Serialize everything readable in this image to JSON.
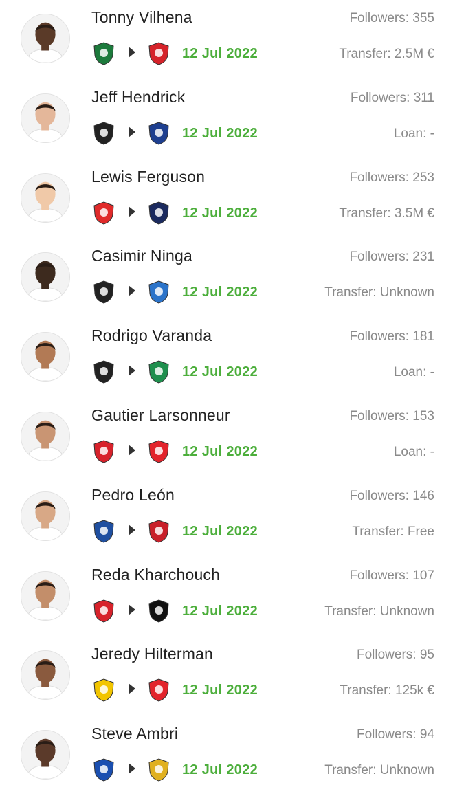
{
  "transfers": [
    {
      "player": "Tonny Vilhena",
      "followers": "Followers: 355",
      "fee": "Transfer: 2.5M €",
      "date": "12 Jul 2022",
      "from_icon": "krasnodar-crest-icon",
      "to_icon": "espanyol-crest-icon",
      "from_color": "#1c7a3c",
      "to_color": "#d5232a",
      "skin": "#5a3a28"
    },
    {
      "player": "Jeff Hendrick",
      "followers": "Followers: 311",
      "fee": "Loan: -",
      "date": "12 Jul 2022",
      "from_icon": "newcastle-crest-icon",
      "to_icon": "reading-crest-icon",
      "from_color": "#222222",
      "to_color": "#1e3f8f",
      "skin": "#e4b79a"
    },
    {
      "player": "Lewis Ferguson",
      "followers": "Followers: 253",
      "fee": "Transfer: 3.5M €",
      "date": "12 Jul 2022",
      "from_icon": "aberdeen-crest-icon",
      "to_icon": "bologna-crest-icon",
      "from_color": "#e02a2a",
      "to_color": "#1b2a5e",
      "skin": "#f0c9a8"
    },
    {
      "player": "Casimir Ninga",
      "followers": "Followers: 231",
      "fee": "Transfer: Unknown",
      "date": "12 Jul 2022",
      "from_icon": "angers-crest-icon",
      "to_icon": "anorthosis-crest-icon",
      "from_color": "#222222",
      "to_color": "#2b73c9",
      "skin": "#3d2a1e"
    },
    {
      "player": "Rodrigo Varanda",
      "followers": "Followers: 181",
      "fee": "Loan: -",
      "date": "12 Jul 2022",
      "from_icon": "corinthians-crest-icon",
      "to_icon": "omonia-crest-icon",
      "from_color": "#222222",
      "to_color": "#1f8f4e",
      "skin": "#b27a55"
    },
    {
      "player": "Gautier Larsonneur",
      "followers": "Followers: 153",
      "fee": "Loan: -",
      "date": "12 Jul 2022",
      "from_icon": "brest-crest-icon",
      "to_icon": "valenciennes-crest-icon",
      "from_color": "#d7222b",
      "to_color": "#e2242c",
      "skin": "#c99573"
    },
    {
      "player": "Pedro León",
      "followers": "Followers: 146",
      "fee": "Transfer: Free",
      "date": "12 Jul 2022",
      "from_icon": "fuenlabrada-crest-icon",
      "to_icon": "real-murcia-crest-icon",
      "from_color": "#1f4fa0",
      "to_color": "#c8202a",
      "skin": "#d8a886"
    },
    {
      "player": "Reda Kharchouch",
      "followers": "Followers: 107",
      "fee": "Transfer: Unknown",
      "date": "12 Jul 2022",
      "from_icon": "sparta-crest-icon",
      "to_icon": "excelsior-crest-icon",
      "from_color": "#d7222b",
      "to_color": "#111111",
      "skin": "#c38e6a"
    },
    {
      "player": "Jeredy Hilterman",
      "followers": "Followers: 95",
      "fee": "Transfer: 125k €",
      "date": "12 Jul 2022",
      "from_icon": "nac-breda-crest-icon",
      "to_icon": "almere-city-crest-icon",
      "from_color": "#f2c500",
      "to_color": "#e2242c",
      "skin": "#8a5a3e"
    },
    {
      "player": "Steve Ambri",
      "followers": "Followers: 94",
      "fee": "Transfer: Unknown",
      "date": "12 Jul 2022",
      "from_icon": "sochaux-crest-icon",
      "to_icon": "sheriff-crest-icon",
      "from_color": "#1a4fb0",
      "to_color": "#e0b020",
      "skin": "#5b3a2a"
    }
  ]
}
